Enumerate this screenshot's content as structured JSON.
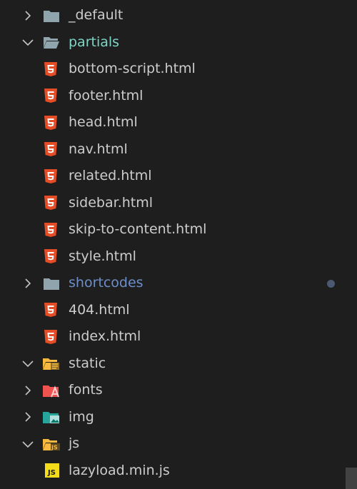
{
  "explorer": {
    "items": [
      {
        "label": "_default",
        "type": "folder",
        "expanded": false,
        "icon": "folder-icon"
      },
      {
        "label": "partials",
        "type": "folder-open",
        "expanded": true,
        "icon": "folder-open-icon"
      },
      {
        "label": "bottom-script.html",
        "type": "html",
        "icon": "html5-icon"
      },
      {
        "label": "footer.html",
        "type": "html",
        "icon": "html5-icon"
      },
      {
        "label": "head.html",
        "type": "html",
        "icon": "html5-icon"
      },
      {
        "label": "nav.html",
        "type": "html",
        "icon": "html5-icon"
      },
      {
        "label": "related.html",
        "type": "html",
        "icon": "html5-icon"
      },
      {
        "label": "sidebar.html",
        "type": "html",
        "icon": "html5-icon"
      },
      {
        "label": "skip-to-content.html",
        "type": "html",
        "icon": "html5-icon"
      },
      {
        "label": "style.html",
        "type": "html",
        "icon": "html5-icon"
      },
      {
        "label": "shortcodes",
        "type": "folder",
        "expanded": false,
        "icon": "folder-icon",
        "modified": true
      },
      {
        "label": "404.html",
        "type": "html",
        "icon": "html5-icon"
      },
      {
        "label": "index.html",
        "type": "html",
        "icon": "html5-icon"
      },
      {
        "label": "static",
        "type": "folder-static",
        "expanded": true,
        "icon": "static-folder-icon"
      },
      {
        "label": "fonts",
        "type": "folder-fonts",
        "expanded": false,
        "icon": "fonts-folder-icon"
      },
      {
        "label": "img",
        "type": "folder-img",
        "expanded": false,
        "icon": "image-folder-icon"
      },
      {
        "label": "js",
        "type": "folder-js",
        "expanded": true,
        "icon": "js-folder-icon"
      },
      {
        "label": "lazyload.min.js",
        "type": "js",
        "icon": "javascript-icon"
      }
    ]
  },
  "colors": {
    "background": "#1e1e1e",
    "text": "#cccccc",
    "folder_open_label": "#7fd5c6",
    "modified_label": "#6d8ec9",
    "html_icon": "#e44d26",
    "js_icon": "#f5de19"
  }
}
